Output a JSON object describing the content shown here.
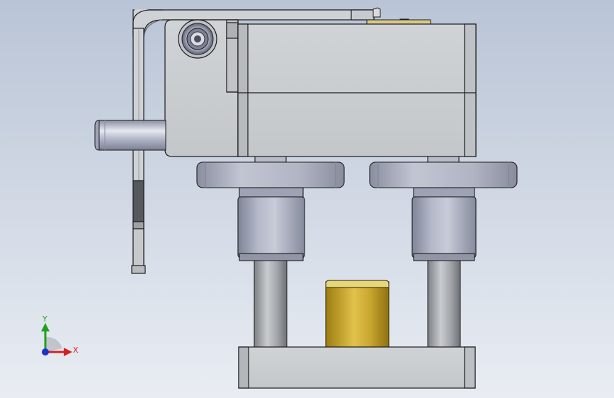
{
  "viewport": {
    "background_top": "#b9c4d6",
    "background_bottom": "#e9edf3"
  },
  "triad": {
    "x_label": "X",
    "y_label": "Y",
    "x_color": "#d42020",
    "y_color": "#1fa01f",
    "z_color": "#1a33d0"
  },
  "model": {
    "plate_color": "#c9cdd0",
    "edge_color": "#1c1c1c",
    "shaft_color": "#aab0c2",
    "guide_rod_color": "#9a9ea3",
    "bushing_color": "#c9a630",
    "bearing_color": "#a5a9ba"
  }
}
